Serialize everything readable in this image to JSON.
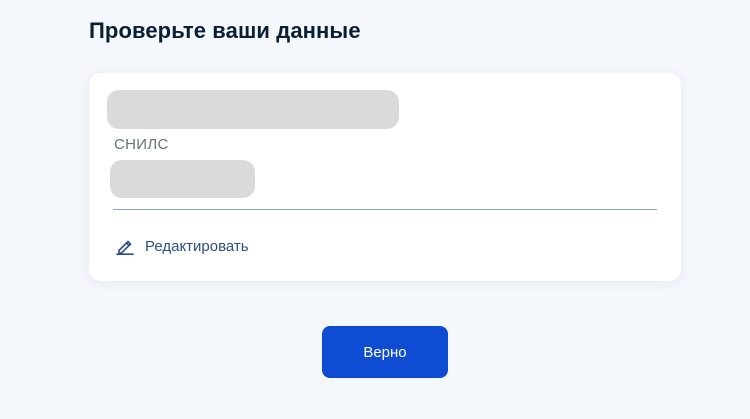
{
  "page": {
    "title": "Проверьте ваши данные"
  },
  "card": {
    "snils_label": "СНИЛС",
    "edit_label": "Редактировать"
  },
  "actions": {
    "confirm_label": "Верно"
  },
  "icons": {
    "edit": "pencil-icon"
  },
  "colors": {
    "primary": "#0d4cd3",
    "title": "#0b1f33",
    "link": "#2b4f82",
    "muted": "#66727f",
    "mask": "#dadada",
    "background": "#f4f7fc"
  }
}
